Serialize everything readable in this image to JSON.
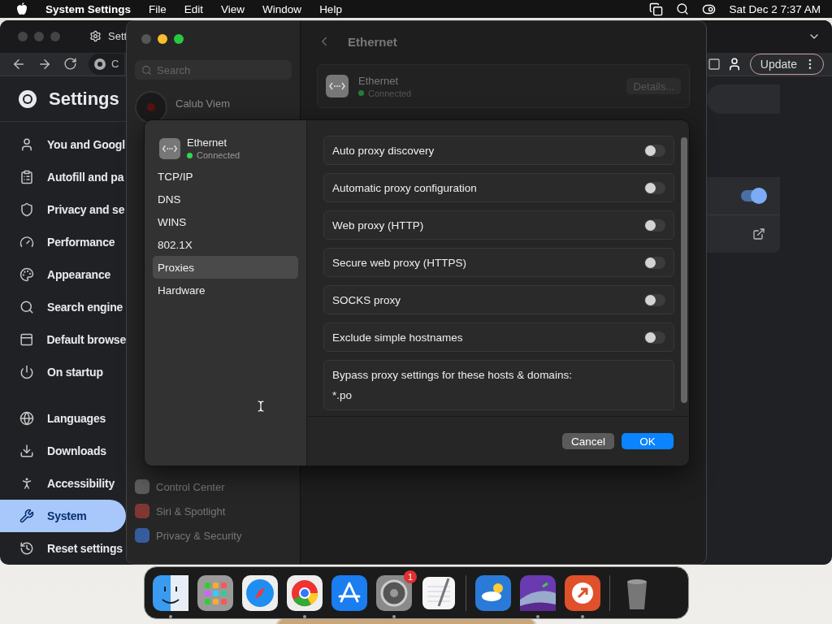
{
  "menu_bar": {
    "app": "System Settings",
    "menus": [
      "File",
      "Edit",
      "View",
      "Window",
      "Help"
    ],
    "clock": "Sat Dec 2  7:37 AM"
  },
  "browser": {
    "tab_title": "Sett",
    "address": "C",
    "update_button": "Update",
    "page_title": "Settings",
    "toggle": {
      "on": true
    },
    "nav": [
      {
        "label": "You and Googl",
        "selected": false
      },
      {
        "label": "Autofill and pa",
        "selected": false
      },
      {
        "label": "Privacy and se",
        "selected": false
      },
      {
        "label": "Performance",
        "selected": false
      },
      {
        "label": "Appearance",
        "selected": false
      },
      {
        "label": "Search engine",
        "selected": false
      },
      {
        "label": "Default browse",
        "selected": false
      },
      {
        "label": "On startup",
        "selected": false
      },
      {
        "label": "Languages",
        "selected": false
      },
      {
        "label": "Downloads",
        "selected": false
      },
      {
        "label": "Accessibility",
        "selected": false
      },
      {
        "label": "System",
        "selected": true
      },
      {
        "label": "Reset settings",
        "selected": false
      }
    ]
  },
  "settings_window": {
    "search_placeholder": "Search",
    "account_name": "Calub Viem",
    "title": "Ethernet",
    "service": {
      "name": "Ethernet",
      "status": "Connected"
    },
    "details_button": "Details...",
    "sidebar": [
      "Control Center",
      "Siri & Spotlight",
      "Privacy & Security"
    ]
  },
  "sheet": {
    "service": {
      "name": "Ethernet",
      "status": "Connected"
    },
    "tabs": [
      {
        "label": "TCP/IP",
        "selected": false
      },
      {
        "label": "DNS",
        "selected": false
      },
      {
        "label": "WINS",
        "selected": false
      },
      {
        "label": "802.1X",
        "selected": false
      },
      {
        "label": "Proxies",
        "selected": true
      },
      {
        "label": "Hardware",
        "selected": false
      }
    ],
    "options": [
      {
        "label": "Auto proxy discovery",
        "on": false
      },
      {
        "label": "Automatic proxy configuration",
        "on": false
      },
      {
        "label": "Web proxy (HTTP)",
        "on": false
      },
      {
        "label": "Secure web proxy (HTTPS)",
        "on": false
      },
      {
        "label": "SOCKS proxy",
        "on": false
      },
      {
        "label": "Exclude simple hostnames",
        "on": false
      }
    ],
    "bypass": {
      "label": "Bypass proxy settings for these hosts & domains:",
      "value": "*.po"
    },
    "buttons": [
      {
        "label": "Cancel",
        "kind": "secondary"
      },
      {
        "label": "OK",
        "kind": "primary"
      }
    ]
  },
  "dock": {
    "apps": [
      {
        "kind": "finder",
        "running": true
      },
      {
        "kind": "launchpad",
        "running": false
      },
      {
        "kind": "safari",
        "running": false
      },
      {
        "kind": "chrome",
        "running": true
      },
      {
        "kind": "appstore",
        "running": false
      },
      {
        "kind": "settings",
        "running": true,
        "badge": "1"
      },
      {
        "kind": "textedit",
        "running": false
      },
      {
        "kind": "separator"
      },
      {
        "kind": "weather",
        "running": false
      },
      {
        "kind": "landscape",
        "running": true
      },
      {
        "kind": "remote",
        "running": true
      },
      {
        "kind": "separator"
      },
      {
        "kind": "trash",
        "running": false
      }
    ]
  }
}
